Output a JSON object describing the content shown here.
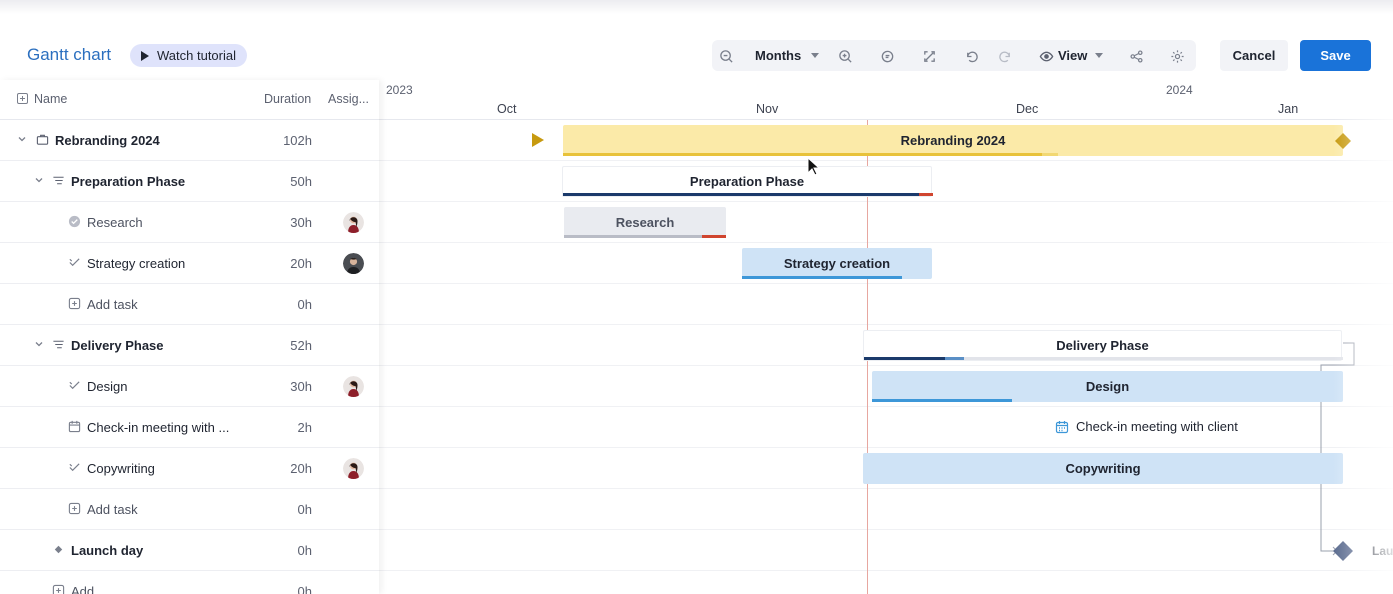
{
  "header": {
    "title": "Gantt chart",
    "tutorial_label": "Watch tutorial",
    "toolbar": {
      "zoom_unit": "Months",
      "view_label": "View",
      "icons": [
        "zoom-out-icon",
        "zoom-in-icon",
        "comment-icon",
        "fullscreen-icon",
        "undo-icon",
        "redo-icon",
        "eye-icon",
        "share-icon",
        "settings-icon"
      ]
    },
    "cancel_label": "Cancel",
    "save_label": "Save"
  },
  "grid": {
    "columns": {
      "name": "Name",
      "duration": "Duration",
      "assignee": "Assig..."
    },
    "rows": [
      {
        "name": "Rebranding 2024",
        "duration": "102h",
        "type": "project",
        "icon": "briefcase-icon"
      },
      {
        "name": "Preparation Phase",
        "duration": "50h",
        "type": "phase",
        "icon": "phase-icon"
      },
      {
        "name": "Research",
        "duration": "30h",
        "type": "task",
        "icon": "completed-check-icon",
        "assignee": "female"
      },
      {
        "name": "Strategy creation",
        "duration": "20h",
        "type": "task",
        "icon": "task-check-icon",
        "assignee": "male"
      },
      {
        "name": "Add task",
        "duration": "0h",
        "type": "add",
        "icon": "plus-square-icon"
      },
      {
        "name": "Delivery Phase",
        "duration": "52h",
        "type": "phase",
        "icon": "phase-icon"
      },
      {
        "name": "Design",
        "duration": "30h",
        "type": "task",
        "icon": "task-check-icon",
        "assignee": "female"
      },
      {
        "name": "Check-in meeting with ...",
        "duration": "2h",
        "type": "meeting",
        "icon": "calendar-icon"
      },
      {
        "name": "Copywriting",
        "duration": "20h",
        "type": "task",
        "icon": "task-check-icon",
        "assignee": "female"
      },
      {
        "name": "Add task",
        "duration": "0h",
        "type": "add",
        "icon": "plus-square-icon"
      },
      {
        "name": "Launch day",
        "duration": "0h",
        "type": "milestone",
        "icon": "diamond-icon"
      },
      {
        "name": "Add",
        "duration": "0h",
        "type": "add",
        "icon": "plus-square-icon"
      }
    ]
  },
  "timeline": {
    "years": [
      "2023",
      "2024"
    ],
    "months": [
      "Oct",
      "Nov",
      "Dec",
      "Jan"
    ],
    "bars": {
      "project": "Rebranding 2024",
      "prep": "Preparation Phase",
      "research": "Research",
      "strategy": "Strategy creation",
      "delivery": "Delivery Phase",
      "design": "Design",
      "meeting": "Check-in meeting with client",
      "copywriting": "Copywriting",
      "launch": "Laun"
    },
    "colors": {
      "project": "#fbeaa8",
      "project_progress": "#e8c23a",
      "task": "#cfe3f6",
      "task_progress": "#3d97d8",
      "phase_progress": "#1b3a6b",
      "overdue": "#d0452f",
      "today": "#e7a7a0",
      "milestone": "#5a6a8e",
      "project_marker": "#c79a10"
    }
  }
}
